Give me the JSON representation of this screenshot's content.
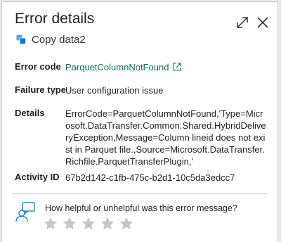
{
  "dialog": {
    "title": "Error details",
    "subtitle": "Copy data2",
    "subtitle_icon": "copy-activity-icon",
    "expand_icon": "expand-icon",
    "close_icon": "close-icon"
  },
  "details": {
    "error_code_label": "Error code",
    "error_code_value": "ParquetColumnNotFound",
    "failure_type_label": "Failure type",
    "failure_type_value": "User configuration issue",
    "details_label": "Details",
    "details_value": "ErrorCode=ParquetColumnNotFound,'Type=Microsoft.DataTransfer.Common.Shared.HybridDeliveryException,Message=Column lineid does not exist in Parquet file.,Source=Microsoft.DataTransfer.Richfile.ParquetTransferPlugin,'",
    "activity_id_label": "Activity ID",
    "activity_id_value": "67b2d142-c1fb-475c-b2d1-10c5da3edcc7"
  },
  "feedback": {
    "question": "How helpful or unhelpful was this error message?",
    "rating": 0,
    "max_rating": 5
  },
  "colors": {
    "link": "#0e6a53",
    "icon_blue": "#0078d4",
    "star": "#c8c6c4"
  }
}
